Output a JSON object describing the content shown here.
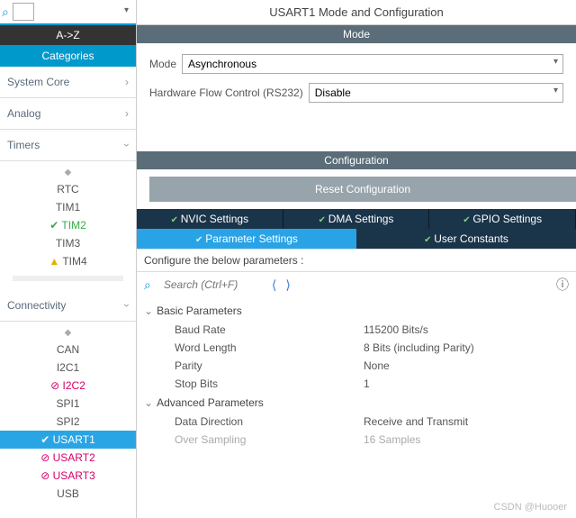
{
  "title": "USART1 Mode and Configuration",
  "modeBand": "Mode",
  "cfgBand": "Configuration",
  "modeLabel": "Mode",
  "modeVal": "Asynchronous",
  "hwLabel": "Hardware Flow Control (RS232)",
  "hwVal": "Disable",
  "resetBtn": "Reset Configuration",
  "tabs1": [
    "NVIC Settings",
    "DMA Settings",
    "GPIO Settings"
  ],
  "tabs2": [
    "Parameter Settings",
    "User Constants"
  ],
  "hint": "Configure the below parameters :",
  "searchPH": "Search (Ctrl+F)",
  "basic": {
    "title": "Basic Parameters",
    "rows": [
      {
        "k": "Baud Rate",
        "v": "115200 Bits/s"
      },
      {
        "k": "Word Length",
        "v": "8 Bits (including Parity)"
      },
      {
        "k": "Parity",
        "v": "None"
      },
      {
        "k": "Stop Bits",
        "v": "1"
      }
    ]
  },
  "adv": {
    "title": "Advanced Parameters",
    "rows": [
      {
        "k": "Data Direction",
        "v": "Receive and Transmit"
      },
      {
        "k": "Over Sampling",
        "v": "16 Samples"
      }
    ]
  },
  "side": {
    "tabA": "A->Z",
    "tabB": "Categories",
    "c0": "System Core",
    "c1": "Analog",
    "c2": "Timers",
    "c3": "Connectivity",
    "timers": [
      "RTC",
      "TIM1",
      "TIM2",
      "TIM3",
      "TIM4"
    ],
    "conn": [
      "CAN",
      "I2C1",
      "I2C2",
      "SPI1",
      "SPI2",
      "USART1",
      "USART2",
      "USART3",
      "USB"
    ]
  },
  "wm": "CSDN @Huooer"
}
